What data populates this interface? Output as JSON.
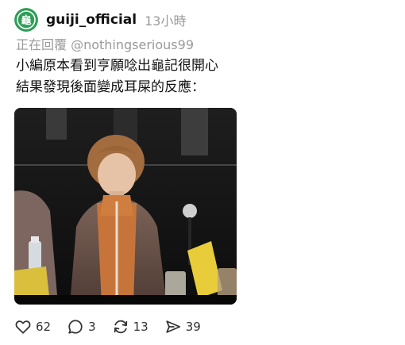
{
  "post": {
    "author": "guiji_official",
    "time": "13小時",
    "reply_to": "正在回覆 @nothingserious99",
    "text_lines": [
      "小編原本看到亨願唸出龜記很開心",
      "結果發現後面變成耳屎的反應："
    ],
    "avatar_icon": "guiji-logo-icon",
    "brand_color": "#2e9e57"
  },
  "actions": {
    "likes": "62",
    "comments": "3",
    "reposts": "13",
    "shares": "39"
  }
}
